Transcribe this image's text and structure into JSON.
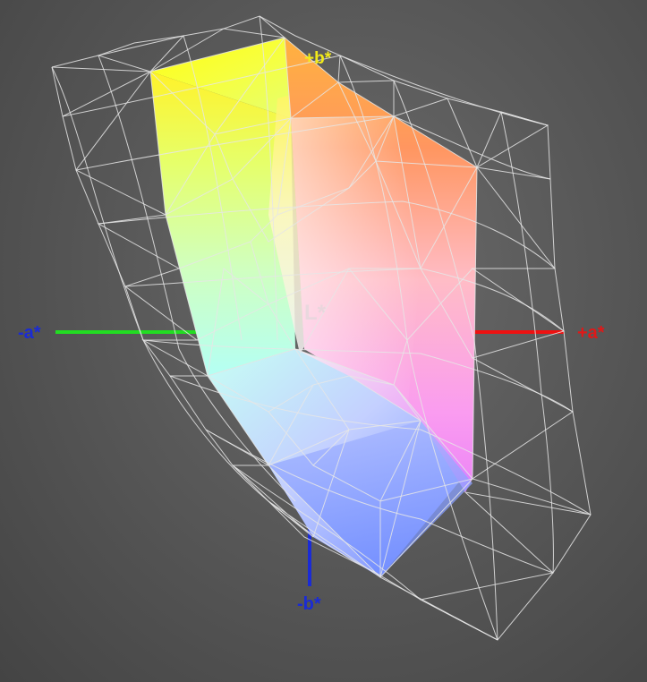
{
  "axes": {
    "neg_a": {
      "label": "-a*",
      "color": "#1a2bd6"
    },
    "pos_a": {
      "label": "+a*",
      "color": "#e01818"
    },
    "pos_b": {
      "label": "+b*",
      "color": "#f2ea1a"
    },
    "neg_b": {
      "label": "-b*",
      "color": "#1a2bd6"
    },
    "lightness": {
      "label": "L*",
      "color": "#d8d8d8"
    }
  },
  "colors": {
    "green_axis": "#22dd22",
    "red_axis": "#ee1111",
    "blue_axis": "#1a2bd6",
    "wireframe": "#e6e6e6",
    "background": "#595959"
  },
  "solid_colors": {
    "yellow": "#ffff1e",
    "orange": "#ffa040",
    "red_orange": "#ff8a60",
    "pink": "#ffb0c8",
    "magenta": "#f07cf4",
    "cyan": "#b8fff6",
    "green_yellow": "#dcff70",
    "blue": "#6e8cff",
    "white": "#fbfbfb"
  }
}
